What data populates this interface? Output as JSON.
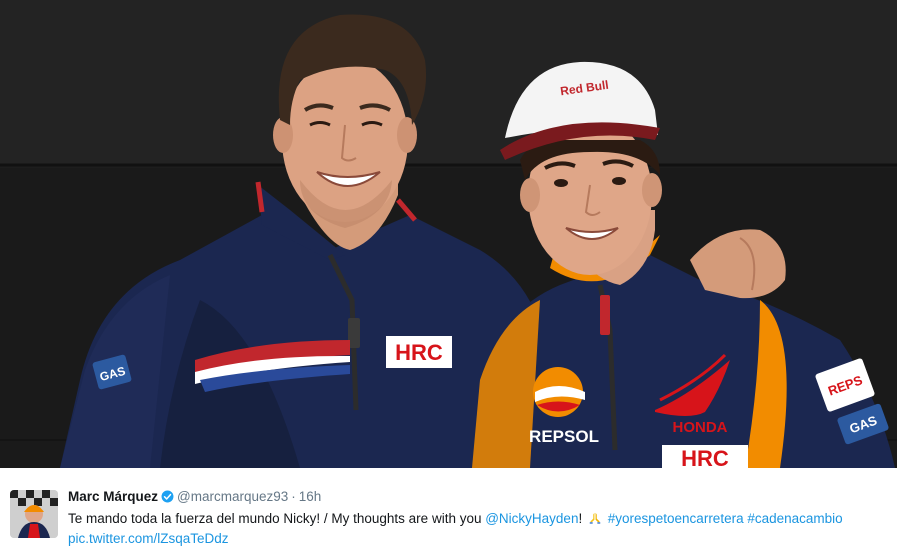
{
  "tweet": {
    "author_name": "Marc Márquez",
    "author_handle": "@marcmarquez93",
    "separator": "·",
    "timestamp": "16h",
    "text_main": "Te mando toda la fuerza del mundo Nicky! / My thoughts are with you ",
    "mention": "@NickyHayden",
    "exclamation": "!",
    "emoji": "praying-hands",
    "hashtags": [
      "#yorespetoencarretera",
      "#cadenacambio"
    ],
    "pic_link": "pic.twitter.com/lZsqaTeDdz"
  },
  "photo": {
    "jacket_logos": [
      "HRC",
      "GAS",
      "REPSOL",
      "HONDA",
      "HRC",
      "REPSOL",
      "GAS"
    ]
  },
  "colors": {
    "link": "#1b95e0",
    "secondary_text": "#657786",
    "verified": "#1da1f2",
    "jacket_navy": "#1b2750",
    "honda_red": "#d7141a",
    "repsol_orange": "#f28c00"
  }
}
